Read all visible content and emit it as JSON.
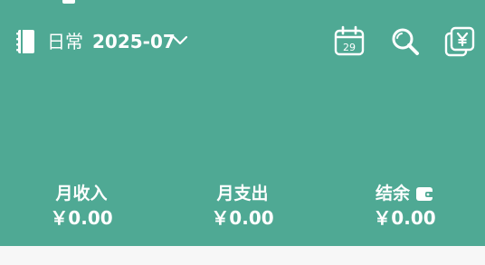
{
  "theme": {
    "header_bg": "#4fa994",
    "page_bg": "#f7f7f7",
    "text": "#ffffff"
  },
  "topbar": {
    "ledger_name": "日常",
    "month": "2025-07",
    "icons": [
      "ledger-book-icon",
      "chevron-down-icon",
      "calendar-icon",
      "search-icon",
      "yuan-copy-icon"
    ],
    "calendar_day": "29"
  },
  "summary": {
    "income": {
      "label": "月收入",
      "value": "￥0.00"
    },
    "expense": {
      "label": "月支出",
      "value": "￥0.00"
    },
    "balance": {
      "label": "结余",
      "value": "￥0.00",
      "icon": "wallet-icon"
    }
  }
}
